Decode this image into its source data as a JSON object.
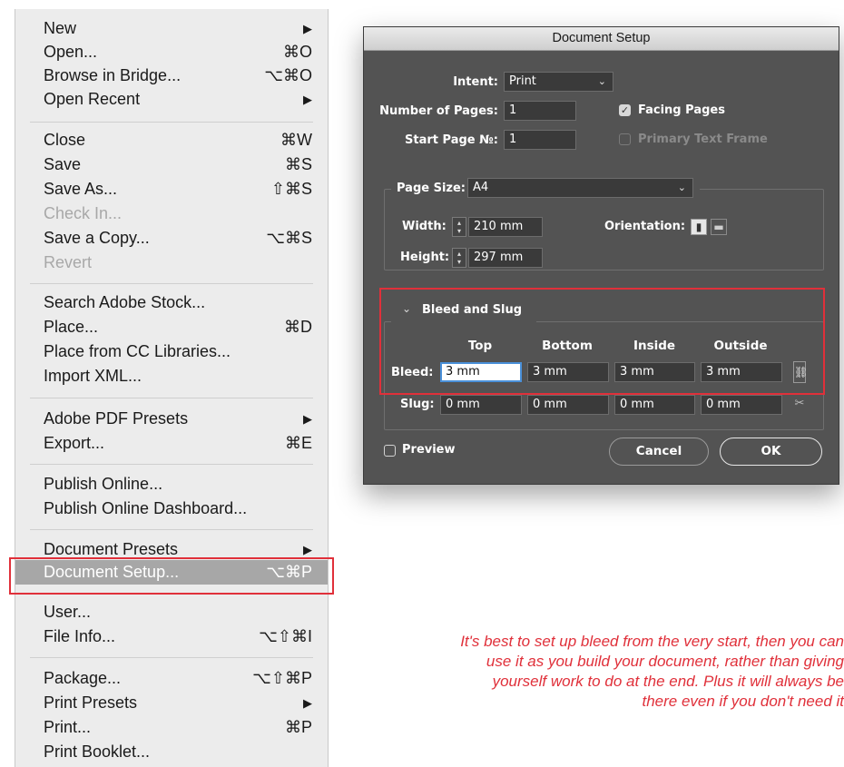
{
  "menu": {
    "items": [
      {
        "label": "New",
        "shortcut": "▶"
      },
      {
        "label": "Open...",
        "shortcut": "⌘O"
      },
      {
        "label": "Browse in Bridge...",
        "shortcut": "⌥⌘O"
      },
      {
        "label": "Open Recent",
        "shortcut": "▶"
      },
      {
        "label": "Close",
        "shortcut": "⌘W"
      },
      {
        "label": "Save",
        "shortcut": "⌘S"
      },
      {
        "label": "Save As...",
        "shortcut": "⇧⌘S"
      },
      {
        "label": "Check In...",
        "shortcut": ""
      },
      {
        "label": "Save a Copy...",
        "shortcut": "⌥⌘S"
      },
      {
        "label": "Revert",
        "shortcut": ""
      },
      {
        "label": "Search Adobe Stock...",
        "shortcut": ""
      },
      {
        "label": "Place...",
        "shortcut": "⌘D"
      },
      {
        "label": "Place from CC Libraries...",
        "shortcut": ""
      },
      {
        "label": "Import XML...",
        "shortcut": ""
      },
      {
        "label": "Adobe PDF Presets",
        "shortcut": "▶"
      },
      {
        "label": "Export...",
        "shortcut": "⌘E"
      },
      {
        "label": "Publish Online...",
        "shortcut": ""
      },
      {
        "label": "Publish Online Dashboard...",
        "shortcut": ""
      },
      {
        "label": "Document Presets",
        "shortcut": "▶"
      },
      {
        "label": "Document Setup...",
        "shortcut": "⌥⌘P"
      },
      {
        "label": "User...",
        "shortcut": ""
      },
      {
        "label": "File Info...",
        "shortcut": "⌥⇧⌘I"
      },
      {
        "label": "Package...",
        "shortcut": "⌥⇧⌘P"
      },
      {
        "label": "Print Presets",
        "shortcut": "▶"
      },
      {
        "label": "Print...",
        "shortcut": "⌘P"
      },
      {
        "label": "Print Booklet...",
        "shortcut": ""
      }
    ]
  },
  "dialog": {
    "title": "Document Setup",
    "intent_label": "Intent:",
    "intent_value": "Print",
    "pages_label": "Number of Pages:",
    "pages_value": "1",
    "start_label": "Start Page №:",
    "start_value": "1",
    "facing_pages": "Facing Pages",
    "primary_text_frame": "Primary Text Frame",
    "page_size_label": "Page Size:",
    "page_size_value": "A4",
    "width_label": "Width:",
    "width_value": "210 mm",
    "height_label": "Height:",
    "height_value": "297 mm",
    "orientation_label": "Orientation:",
    "bleed_section": "Bleed and Slug",
    "columns": [
      "Top",
      "Bottom",
      "Inside",
      "Outside"
    ],
    "bleed_label": "Bleed:",
    "bleed_values": [
      "3 mm",
      "3 mm",
      "3 mm",
      "3 mm"
    ],
    "slug_label": "Slug:",
    "slug_values": [
      "0 mm",
      "0 mm",
      "0 mm",
      "0 mm"
    ],
    "preview_label": "Preview",
    "cancel_label": "Cancel",
    "ok_label": "OK"
  },
  "caption": "It's best to set up bleed from the very start, then you can use it as you build your document, rather than giving yourself work to do at the end. Plus it will always be there even if you don't need it"
}
